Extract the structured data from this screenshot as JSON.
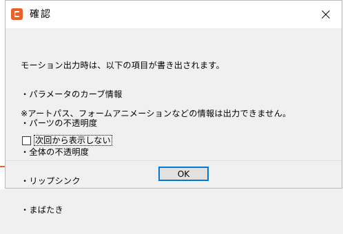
{
  "window": {
    "title": "確認"
  },
  "message": {
    "intro": "モーション出力時は、以下の項目が書き出されます。",
    "items": [
      "・パラメータのカーブ情報",
      "・パーツの不透明度",
      "・全体の不透明度",
      "・リップシンク",
      "・まばたき"
    ],
    "note": "※アートパス、フォームアニメーションなどの情報は出力できません。"
  },
  "checkbox": {
    "label": "次回から表示しない",
    "checked": false
  },
  "buttons": {
    "ok": "OK"
  },
  "colors": {
    "app_icon": "#e8622a",
    "focus_border": "#0078d7"
  },
  "icons": {
    "app": "cubism-logo-icon",
    "close": "close-icon"
  }
}
